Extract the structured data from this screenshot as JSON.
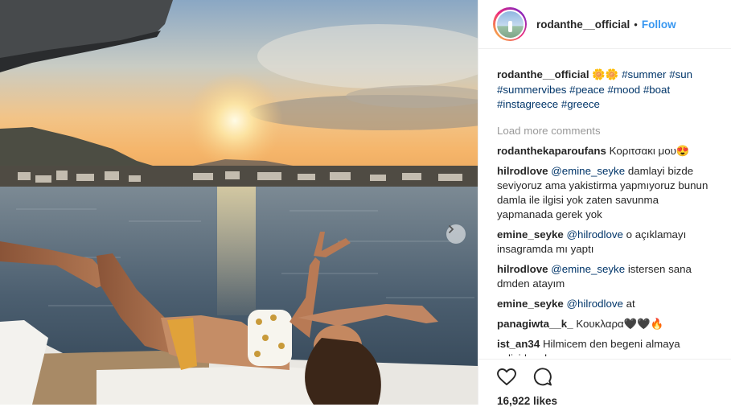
{
  "post": {
    "username": "rodanthe__official",
    "follow_label": "Follow",
    "separator": "•",
    "caption_username": "rodanthe__official",
    "caption_emoji": "🌼🌼",
    "hashtags": [
      "#summer",
      "#sun",
      "#summervibes",
      "#peace",
      "#mood",
      "#boat",
      "#instagreece",
      "#greece"
    ],
    "load_more": "Load more comments",
    "likes": "16,922 likes"
  },
  "comments": [
    {
      "user": "rodanthekaparoufans",
      "mention": "",
      "text": "Κοριτσακι μου😍"
    },
    {
      "user": "hilrodlove",
      "mention": "@emine_seyke",
      "text": "damlayi bizde seviyoruz ama yakistirma yapmıyoruz bunun damla ile ilgisi yok zaten savunma yapmanada gerek yok"
    },
    {
      "user": "emine_seyke",
      "mention": "@hilrodlove",
      "text": "o açıklamayı insagramda mı yaptı"
    },
    {
      "user": "hilrodlove",
      "mention": "@emine_seyke",
      "text": "istersen sana dmden atayım"
    },
    {
      "user": "emine_seyke",
      "mention": "@hilrodlove",
      "text": "at"
    },
    {
      "user": "panagiwta__k_",
      "mention": "",
      "text": "Κουκλαρα🖤🖤🔥"
    },
    {
      "user": "ist_an34",
      "mention": "",
      "text": "Hilmicem den begeni almaya calisirken ben"
    }
  ],
  "icons": {
    "carousel_next": "chevron-right-icon",
    "like": "heart-icon",
    "comment": "speech-bubble-icon"
  },
  "colors": {
    "link": "#003569",
    "follow": "#3897f0",
    "muted": "#999999",
    "text": "#262626"
  }
}
